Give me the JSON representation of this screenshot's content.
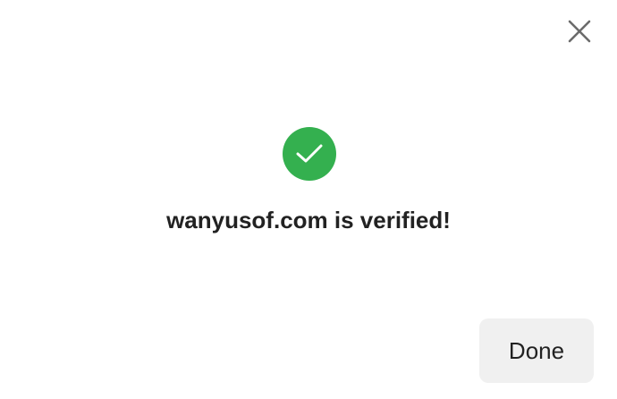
{
  "dialog": {
    "message": "wanyusof.com is verified!",
    "close_icon": "close-icon",
    "status_icon": "check-circle-icon",
    "done_label": "Done"
  },
  "colors": {
    "success": "#34b04f",
    "close_icon": "#6b6b6b",
    "text": "#222222",
    "done_button_bg": "#f0f0f0"
  }
}
